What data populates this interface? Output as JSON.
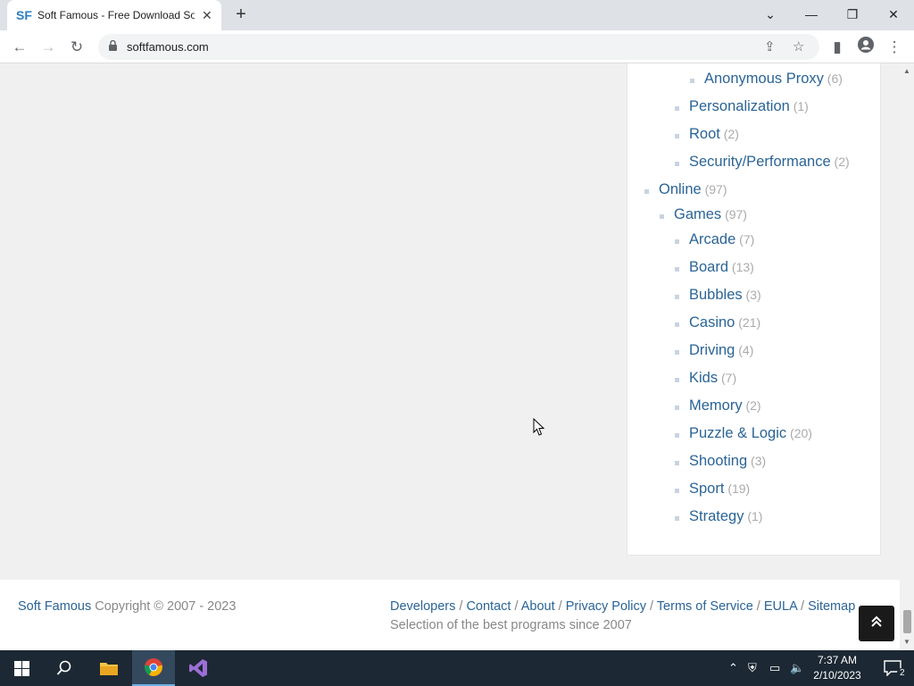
{
  "browser": {
    "tab_title": "Soft Famous - Free Download So",
    "tab_favicon": "SF",
    "url": "softfamous.com"
  },
  "categories": [
    {
      "name": "Anonymous Proxy",
      "count": "(6)",
      "level": 3
    },
    {
      "name": "Personalization",
      "count": "(1)",
      "level": 2
    },
    {
      "name": "Root",
      "count": "(2)",
      "level": 2
    },
    {
      "name": "Security/Performance",
      "count": "(2)",
      "level": 2
    },
    {
      "name": "Online",
      "count": "(97)",
      "level": 0
    },
    {
      "name": "Games",
      "count": "(97)",
      "level": 1
    },
    {
      "name": "Arcade",
      "count": "(7)",
      "level": 2
    },
    {
      "name": "Board",
      "count": "(13)",
      "level": 2
    },
    {
      "name": "Bubbles",
      "count": "(3)",
      "level": 2
    },
    {
      "name": "Casino",
      "count": "(21)",
      "level": 2
    },
    {
      "name": "Driving",
      "count": "(4)",
      "level": 2
    },
    {
      "name": "Kids",
      "count": "(7)",
      "level": 2
    },
    {
      "name": "Memory",
      "count": "(2)",
      "level": 2
    },
    {
      "name": "Puzzle & Logic",
      "count": "(20)",
      "level": 2
    },
    {
      "name": "Shooting",
      "count": "(3)",
      "level": 2
    },
    {
      "name": "Sport",
      "count": "(19)",
      "level": 2
    },
    {
      "name": "Strategy",
      "count": "(1)",
      "level": 2
    }
  ],
  "footer": {
    "brand": "Soft Famous",
    "copyright": " Copyright © 2007 - 2023",
    "links": [
      "Developers",
      "Contact",
      "About",
      "Privacy Policy",
      "Terms of Service",
      "EULA",
      "Sitemap"
    ],
    "separator": " / ",
    "tagline": "Selection of the best programs since 2007"
  },
  "taskbar": {
    "time": "7:37 AM",
    "date": "2/10/2023",
    "notification_count": "2"
  },
  "colors": {
    "link": "#2a6496",
    "count": "#aaaaaa",
    "taskbar": "#1c2833"
  }
}
